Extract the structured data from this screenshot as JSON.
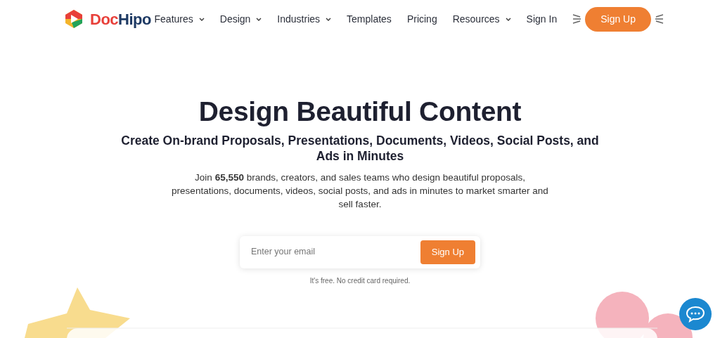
{
  "logo": {
    "parts": [
      {
        "text": "Doc",
        "color": "#e8403a"
      },
      {
        "text": "Hipo",
        "color": "#1e3a64"
      }
    ]
  },
  "nav": [
    {
      "label": "Features",
      "dropdown": true
    },
    {
      "label": "Design",
      "dropdown": true
    },
    {
      "label": "Industries",
      "dropdown": true
    },
    {
      "label": "Templates",
      "dropdown": false
    },
    {
      "label": "Pricing",
      "dropdown": false
    },
    {
      "label": "Resources",
      "dropdown": true
    },
    {
      "label": "Sign In",
      "dropdown": false
    }
  ],
  "nav_button": "Sign Up",
  "hero": {
    "title": "Design Beautiful Content",
    "subtitle": "Create On-brand Proposals, Presentations, Documents, Videos, Social Posts, and Ads in Minutes",
    "text": "Join **65,550** brands, creators, and sales teams who design beautiful proposals, presentations, documents, videos, social posts, and ads in minutes to market smarter and sell faster."
  },
  "signup": {
    "placeholder": "Enter your email",
    "button": "Sign Up",
    "note": "It's free. No credit card required."
  }
}
